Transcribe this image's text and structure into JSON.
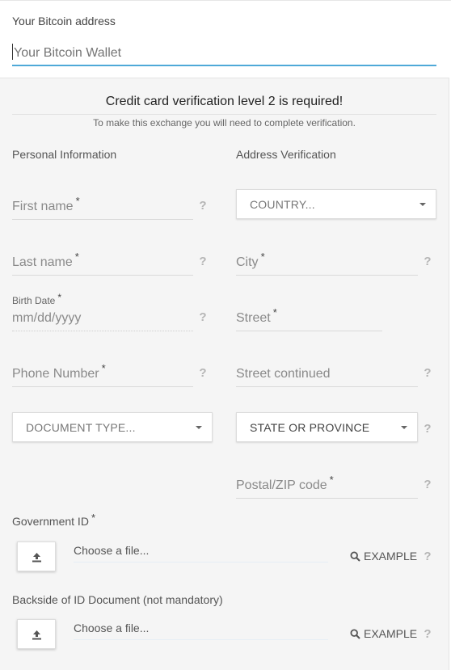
{
  "wallet": {
    "label": "Your Bitcoin address",
    "placeholder": "Your Bitcoin Wallet"
  },
  "notice": {
    "title": "Credit card verification level 2 is required!",
    "subtitle": "To make this exchange you will need to complete verification."
  },
  "personal": {
    "title": "Personal Information",
    "first_name": "First name",
    "last_name": "Last name",
    "birth_label": "Birth Date",
    "birth_placeholder": "mm/dd/yyyy",
    "phone": "Phone Number",
    "document_type": "DOCUMENT TYPE..."
  },
  "address": {
    "title": "Address Verification",
    "country": "COUNTRY...",
    "city": "City",
    "street": "Street",
    "street2": "Street continued",
    "state": "STATE OR PROVINCE",
    "postal": "Postal/ZIP code"
  },
  "uploads": {
    "gov_label": "Government ID",
    "back_label": "Backside of ID Document (not mandatory)",
    "choose": "Choose a file...",
    "example": "EXAMPLE"
  },
  "required_mark": "*",
  "help_mark": "?",
  "icons": [
    "upload-icon",
    "search-icon",
    "chevron-down-icon"
  ],
  "colors": {
    "accent": "#4fa9d8",
    "panel": "#f5f5f5"
  }
}
